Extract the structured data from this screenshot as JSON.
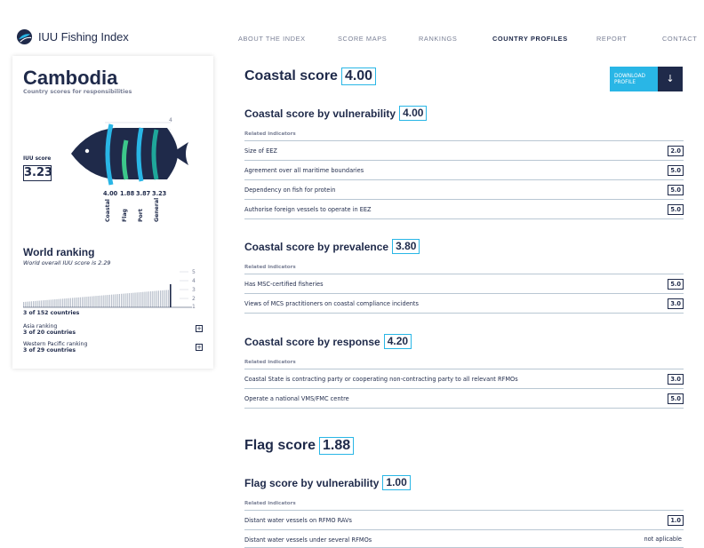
{
  "header": {
    "brand": "IUU Fishing Index",
    "nav": [
      "ABOUT THE INDEX",
      "SCORE MAPS",
      "RANKINGS",
      "COUNTRY PROFILES",
      "REPORT",
      "CONTACT"
    ],
    "active_nav": "COUNTRY PROFILES"
  },
  "profile": {
    "country": "Cambodia",
    "subtitle": "Country scores for responsibilities",
    "iuu_label": "IUU score",
    "iuu_value": "3.23",
    "scale_max": "4",
    "scores": [
      {
        "category": "Coastal",
        "value": "4.00"
      },
      {
        "category": "Flag",
        "value": "1.88"
      },
      {
        "category": "Port",
        "value": "3.87"
      },
      {
        "category": "General",
        "value": "3.23"
      }
    ]
  },
  "ranking": {
    "title": "World ranking",
    "subtitle": "World overall IUU score is 2.29",
    "axis": [
      "5",
      "4",
      "3",
      "2",
      "1"
    ],
    "world_rank": "3 of 152 countries",
    "asia_label": "Asia ranking",
    "asia_rank": "3 of 20 countries",
    "wp_label": "Western Pacific ranking",
    "wp_rank": "3 of 29 countries",
    "expand_icon": "+"
  },
  "download": {
    "label": "DOWNLOAD PROFILE",
    "icon": "↓"
  },
  "coastal": {
    "title": "Coastal score",
    "value": "4.00",
    "related": "Related indicators",
    "vulnerability": {
      "title": "Coastal score by vulnerability",
      "value": "4.00",
      "rows": [
        {
          "label": "Size of EEZ",
          "value": "2.0"
        },
        {
          "label": "Agreement over all maritime boundaries",
          "value": "5.0"
        },
        {
          "label": "Dependency on fish for protein",
          "value": "5.0"
        },
        {
          "label": "Authorise foreign vessels to operate in EEZ",
          "value": "5.0"
        }
      ]
    },
    "prevalence": {
      "title": "Coastal score by prevalence",
      "value": "3.80",
      "rows": [
        {
          "label": "Has MSC-certified fisheries",
          "value": "5.0"
        },
        {
          "label": "Views of MCS practitioners on coastal compliance incidents",
          "value": "3.0"
        }
      ]
    },
    "response": {
      "title": "Coastal score by response",
      "value": "4.20",
      "rows": [
        {
          "label": "Coastal State is contracting party or cooperating non-contracting party to all relevant RFMOs",
          "value": "3.0"
        },
        {
          "label": "Operate a national VMS/FMC centre",
          "value": "5.0"
        }
      ]
    }
  },
  "flag": {
    "title": "Flag score",
    "value": "1.88",
    "related": "Related indicators",
    "vulnerability": {
      "title": "Flag score by vulnerability",
      "value": "1.00",
      "rows": [
        {
          "label": "Distant water vessels on RFMO RAVs",
          "value": "1.0"
        },
        {
          "label": "Distant water vessels under several RFMOs",
          "value": "not aplicable"
        }
      ]
    }
  },
  "colors": {
    "navy": "#1f2a4a",
    "accent": "#29b6e6",
    "teal": "#1fa79a",
    "green": "#3cc78a"
  }
}
